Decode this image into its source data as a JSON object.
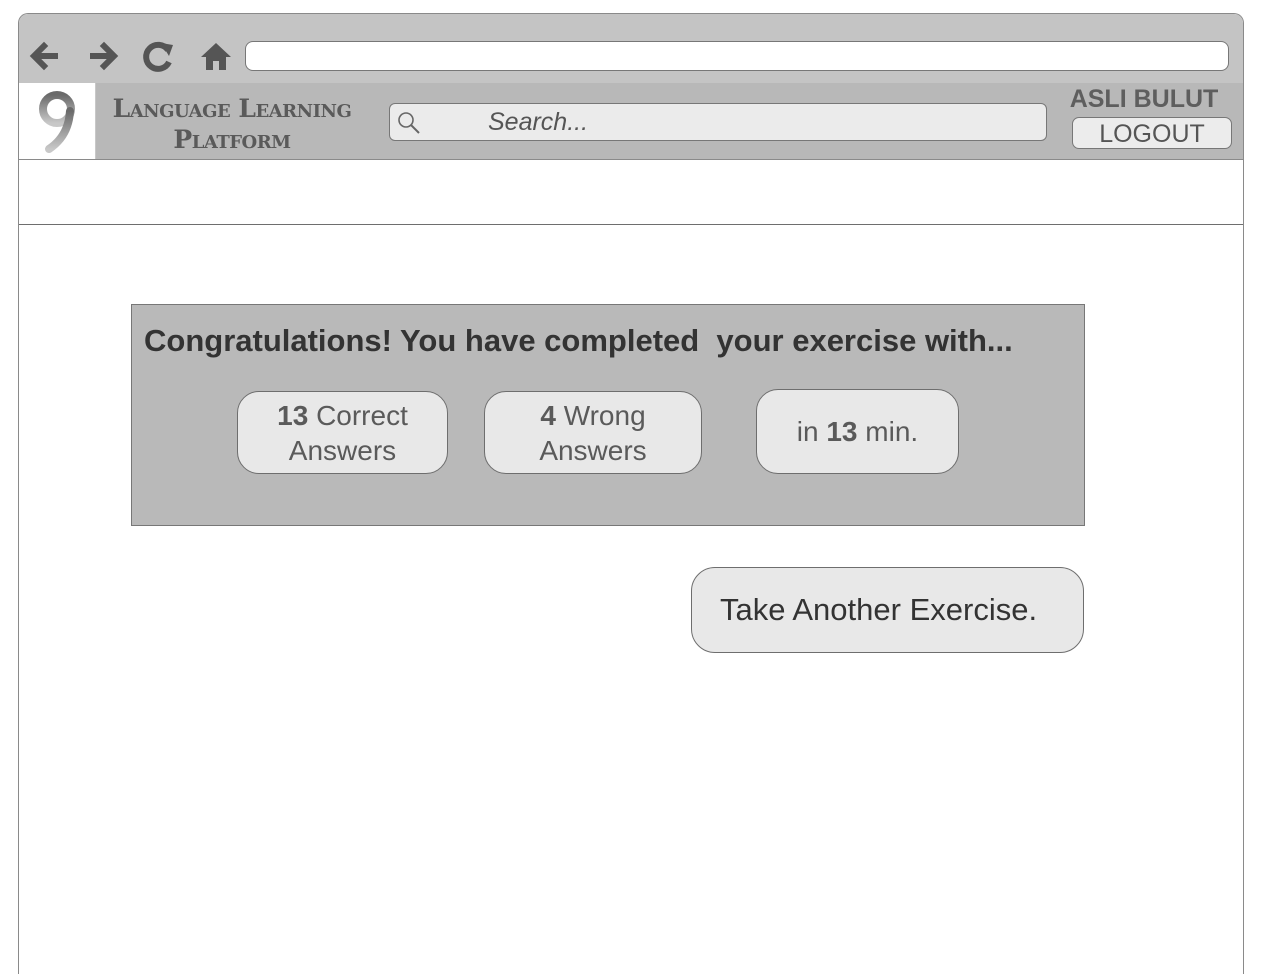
{
  "browser": {
    "address_url": ""
  },
  "header": {
    "app_title_line1": "Language Learning",
    "app_title_line2": "Platform",
    "search_placeholder": "Search...",
    "username": "ASLI BULUT",
    "logout_label": "LOGOUT"
  },
  "results": {
    "heading": "Congratulations! You have completed  your exercise with...",
    "correct_count": "13",
    "correct_label_1": "Correct",
    "correct_label_2": "Answers",
    "wrong_count": "4",
    "wrong_label_1": "Wrong",
    "wrong_label_2": "Answers",
    "time_prefix": "in",
    "time_value": "13",
    "time_suffix": "min."
  },
  "actions": {
    "take_another_label": "Take Another Exercise."
  },
  "icons": [
    "back-arrow-icon",
    "forward-arrow-icon",
    "reload-icon",
    "home-icon",
    "app-logo-icon",
    "search-icon"
  ],
  "colors": {
    "chrome_gray": "#c4c4c4",
    "header_gray": "#b8b8b8",
    "panel_gray": "#b9b9b9",
    "pill_fill": "#e8e8e8"
  }
}
